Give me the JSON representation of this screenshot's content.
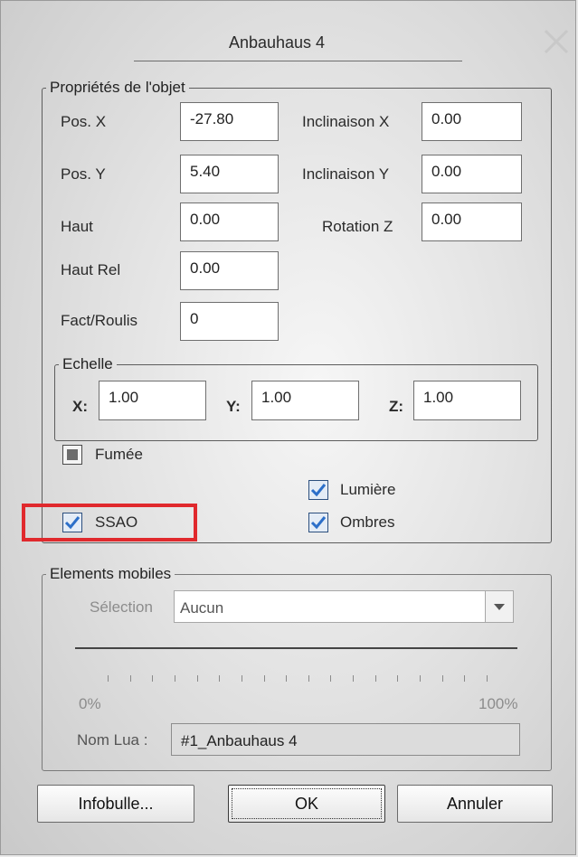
{
  "dialog": {
    "title": "Anbauhaus 4"
  },
  "object_props": {
    "legend": "Propriétés de l'objet",
    "pos_x": {
      "label": "Pos. X",
      "value": "-27.80"
    },
    "pos_y": {
      "label": "Pos. Y",
      "value": "5.40"
    },
    "haut": {
      "label": "Haut",
      "value": "0.00"
    },
    "haut_rel": {
      "label": "Haut Rel",
      "value": "0.00"
    },
    "fact_roulis": {
      "label": "Fact/Roulis",
      "value": "0"
    },
    "incl_x": {
      "label": "Inclinaison X",
      "value": "0.00"
    },
    "incl_y": {
      "label": "Inclinaison Y",
      "value": "0.00"
    },
    "rot_z": {
      "label": "Rotation Z",
      "value": "0.00"
    },
    "scale": {
      "legend": "Echelle",
      "x_label": "X:",
      "x_value": "1.00",
      "y_label": "Y:",
      "y_value": "1.00",
      "z_label": "Z:",
      "z_value": "1.00"
    },
    "fumee": {
      "label": "Fumée",
      "state": "indeterminate"
    },
    "lumiere": {
      "label": "Lumière",
      "checked": true
    },
    "ssao": {
      "label": "SSAO",
      "checked": true
    },
    "ombres": {
      "label": "Ombres",
      "checked": true
    }
  },
  "mobile": {
    "legend": "Elements mobiles",
    "selection_label": "Sélection",
    "selection_value": "Aucun",
    "slider_min": "0%",
    "slider_max": "100%",
    "slider_value": 0,
    "nom_lua_label": "Nom Lua :",
    "nom_lua_value": "#1_Anbauhaus 4"
  },
  "buttons": {
    "infobulle": "Infobulle...",
    "ok": "OK",
    "annuler": "Annuler"
  },
  "colors": {
    "highlight": "#e0292d",
    "checkbox_accent": "#2c6fc9"
  },
  "icons": {
    "close": "close-icon",
    "check": "checkmark-icon",
    "dropdown": "chevron-down-icon"
  }
}
